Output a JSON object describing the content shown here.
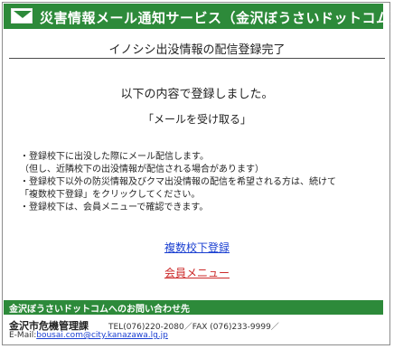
{
  "header": {
    "icon": "mail-icon",
    "title": "災害情報メール通知サービス（金沢ぼうさいドットコム）"
  },
  "page": {
    "title": "イノシシ出没情報の配信登録完了",
    "message": "以下の内容で登録しました。",
    "quote": "「メールを受け取る」"
  },
  "notes": {
    "lines": [
      "・登録校下に出没した際にメール配信します。",
      "（但し、近隣校下の出没情報が配信される場合があります）",
      "・登録校下以外の防災情報及びクマ出没情報の配信を希望される方は、続けて",
      "「複数校下登録」をクリックしてください。",
      "・登録校下は、会員メニューで確認できます。"
    ]
  },
  "links": {
    "multi_register": "複数校下登録",
    "member_menu": "会員メニュー"
  },
  "footer": {
    "contact_title": "金沢ぼうさいドットコムへのお問い合わせ先",
    "org": "金沢市危機管理課",
    "phone": "TEL(076)220-2080／FAX (076)233-9999／",
    "email_label": "E-Mail:",
    "email": "bousai.com@city.kanazawa.lg.jp"
  },
  "colors": {
    "brand_green": "#2d8a3a",
    "link_blue": "#1a3fd1",
    "link_red": "#cc2a2a"
  }
}
